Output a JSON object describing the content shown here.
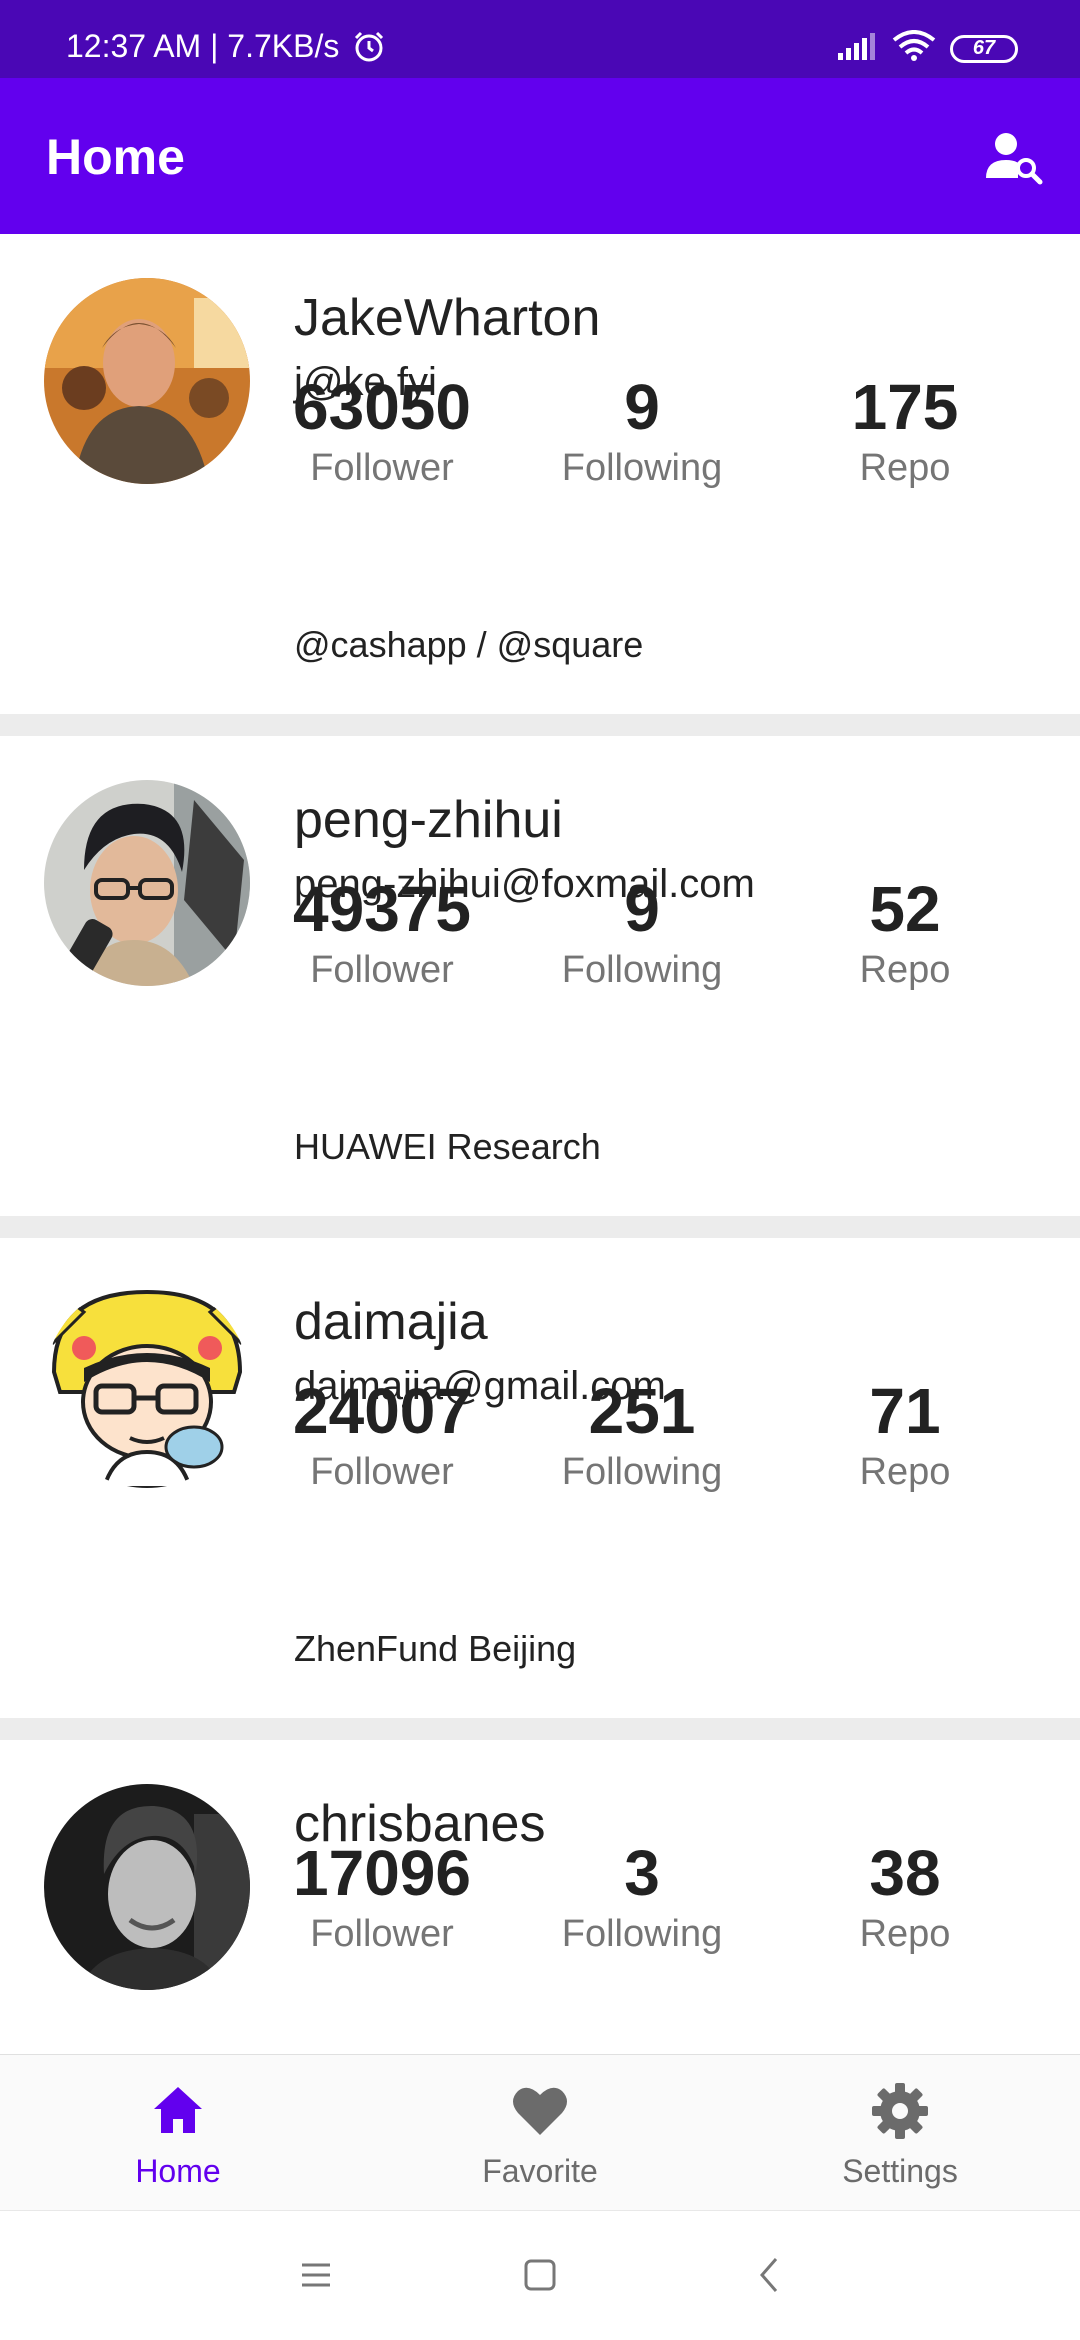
{
  "status_bar": {
    "time_speed": "12:37 AM | 7.7KB/s",
    "battery": "67",
    "icons": [
      "alarm-icon",
      "signal-icon",
      "wifi-icon",
      "battery-icon"
    ]
  },
  "app_bar": {
    "title": "Home",
    "action_icon": "person-search-icon"
  },
  "users": [
    {
      "name": "JakeWharton",
      "email": "j@ke.fyi",
      "followers": "63050",
      "following": "9",
      "repos": "175",
      "company": "@cashapp / @square"
    },
    {
      "name": "peng-zhihui",
      "email": "peng-zhihui@foxmail.com",
      "followers": "49375",
      "following": "9",
      "repos": "52",
      "company": "HUAWEI Research"
    },
    {
      "name": "daimajia",
      "email": "daimajia@gmail.com",
      "followers": "24007",
      "following": "251",
      "repos": "71",
      "company": "ZhenFund Beijing"
    },
    {
      "name": "chrisbanes",
      "followers": "17096",
      "following": "3",
      "repos": "38"
    }
  ],
  "stat_labels": {
    "followers": "Follower",
    "following": "Following",
    "repos": "Repo"
  },
  "bottom_nav": [
    {
      "label": "Home",
      "icon": "home-icon",
      "active": true
    },
    {
      "label": "Favorite",
      "icon": "heart-icon",
      "active": false
    },
    {
      "label": "Settings",
      "icon": "gear-icon",
      "active": false
    }
  ],
  "system_nav": [
    "menu-icon",
    "home-square-icon",
    "back-icon"
  ],
  "colors": {
    "primary": "#6200ee",
    "status_bar": "#4a07b5",
    "inactive": "#6b6b6b"
  }
}
